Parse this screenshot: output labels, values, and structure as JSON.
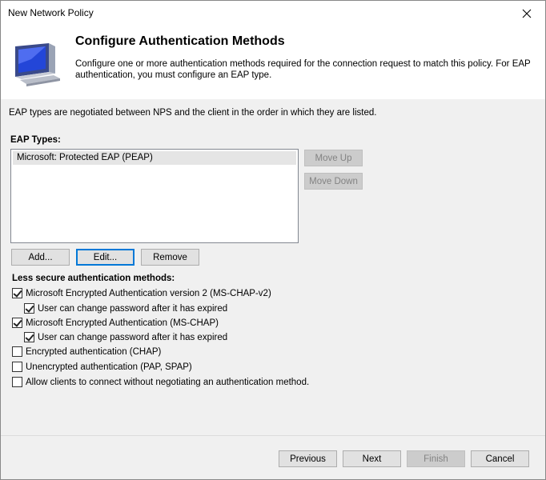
{
  "window": {
    "title": "New Network Policy"
  },
  "header": {
    "title": "Configure Authentication Methods",
    "description": "Configure one or more authentication methods required for the connection request to match this policy. For EAP authentication, you must configure an EAP type."
  },
  "intro_text": "EAP types are negotiated between NPS and the client in the order in which they are listed.",
  "eap": {
    "label": "EAP Types:",
    "items": [
      "Microsoft: Protected EAP (PEAP)"
    ],
    "move_up": "Move Up",
    "move_down": "Move Down",
    "add": "Add...",
    "edit": "Edit...",
    "remove": "Remove"
  },
  "less_secure": {
    "label": "Less secure authentication methods:",
    "options": [
      {
        "label": "Microsoft Encrypted Authentication version 2 (MS-CHAP-v2)",
        "checked": true
      },
      {
        "label": "User can change password after it has expired",
        "checked": true
      },
      {
        "label": "Microsoft Encrypted Authentication (MS-CHAP)",
        "checked": true
      },
      {
        "label": "User can change password after it has expired",
        "checked": true
      },
      {
        "label": "Encrypted authentication (CHAP)",
        "checked": false
      },
      {
        "label": "Unencrypted authentication (PAP, SPAP)",
        "checked": false
      },
      {
        "label": "Allow clients to connect without negotiating an authentication method.",
        "checked": false
      }
    ]
  },
  "footer": {
    "previous": "Previous",
    "next": "Next",
    "finish": "Finish",
    "cancel": "Cancel"
  }
}
